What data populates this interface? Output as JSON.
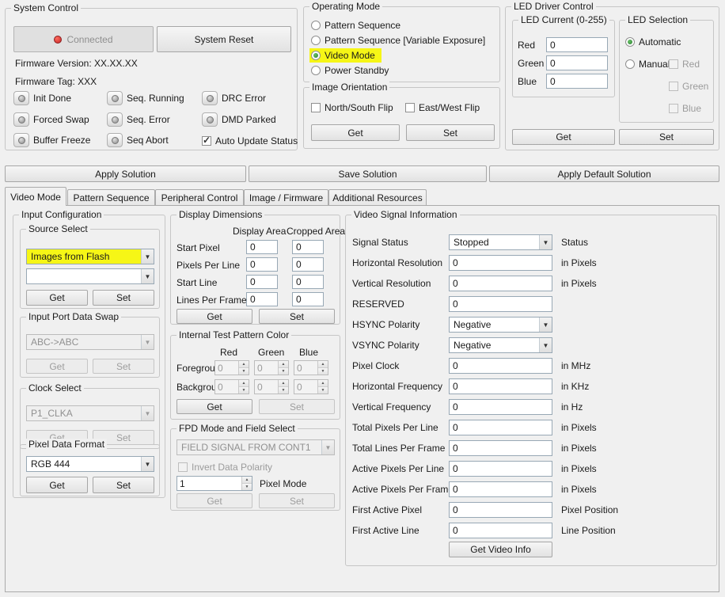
{
  "colors": {
    "highlight": "#f6f616",
    "window_bg": "#f0f0f0",
    "connected_led": "#c62828"
  },
  "system_control": {
    "title": "System Control",
    "connected_button": "Connected",
    "system_reset_button": "System Reset",
    "firmware_version_label": "Firmware Version:  XX.XX.XX",
    "firmware_tag_label": "Firmware Tag:   XXX",
    "status_leds": [
      {
        "label": "Init Done"
      },
      {
        "label": "Seq. Running"
      },
      {
        "label": "DRC Error"
      },
      {
        "label": "Forced Swap"
      },
      {
        "label": "Seq. Error"
      },
      {
        "label": "DMD Parked"
      },
      {
        "label": "Buffer Freeze"
      },
      {
        "label": "Seq Abort"
      }
    ],
    "auto_update_checkbox": {
      "label": "Auto Update Status",
      "checked": true
    }
  },
  "operating_mode": {
    "title": "Operating Mode",
    "options": [
      {
        "label": "Pattern Sequence",
        "selected": false,
        "highlighted": false
      },
      {
        "label": "Pattern Sequence [Variable Exposure]",
        "selected": false,
        "highlighted": false
      },
      {
        "label": "Video Mode",
        "selected": true,
        "highlighted": true
      },
      {
        "label": "Power Standby",
        "selected": false,
        "highlighted": false
      }
    ]
  },
  "image_orientation": {
    "title": "Image Orientation",
    "north_south_flip_label": "North/South Flip",
    "east_west_flip_label": "East/West Flip",
    "get_button": "Get",
    "set_button": "Set"
  },
  "led_driver_control": {
    "title": "LED Driver Control",
    "led_current": {
      "title": "LED Current (0-255)",
      "rows": [
        {
          "label": "Red",
          "value": "0"
        },
        {
          "label": "Green",
          "value": "0"
        },
        {
          "label": "Blue",
          "value": "0"
        }
      ]
    },
    "led_selection": {
      "title": "LED Selection",
      "automatic_label": "Automatic",
      "manual_label": "Manual",
      "channel_checkboxes": [
        {
          "label": "Red"
        },
        {
          "label": "Green"
        },
        {
          "label": "Blue"
        }
      ]
    },
    "get_button": "Get",
    "set_button": "Set"
  },
  "solution_bar": {
    "apply_solution_button": "Apply Solution",
    "save_solution_button": "Save Solution",
    "apply_default_solution_button": "Apply Default Solution"
  },
  "tabs": [
    {
      "label": "Video Mode",
      "active": true
    },
    {
      "label": "Pattern Sequence",
      "active": false
    },
    {
      "label": "Peripheral Control",
      "active": false
    },
    {
      "label": "Image / Firmware",
      "active": false
    },
    {
      "label": "Additional Resources",
      "active": false
    }
  ],
  "input_configuration": {
    "title": "Input Configuration",
    "source_select": {
      "title": "Source Select",
      "selected_value": "Images from Flash",
      "secondary_value": "",
      "get_button": "Get",
      "set_button": "Set"
    },
    "input_port_data_swap": {
      "title": "Input Port Data Swap",
      "selected_value": "ABC->ABC",
      "get_button": "Get",
      "set_button": "Set"
    },
    "clock_select": {
      "title": "Clock Select",
      "selected_value": "P1_CLKA",
      "get_button": "Get",
      "set_button": "Set"
    },
    "pixel_data_format": {
      "title": "Pixel Data Format",
      "selected_value": "RGB 444",
      "get_button": "Get",
      "set_button": "Set"
    }
  },
  "display_dimensions": {
    "title": "Display Dimensions",
    "col_headers": [
      "Display Area",
      "Cropped Area"
    ],
    "rows": [
      {
        "label": "Start Pixel",
        "display_area": "0",
        "cropped_area": "0"
      },
      {
        "label": "Pixels Per Line",
        "display_area": "0",
        "cropped_area": "0"
      },
      {
        "label": "Start Line",
        "display_area": "0",
        "cropped_area": "0"
      },
      {
        "label": "Lines Per Frame",
        "display_area": "0",
        "cropped_area": "0"
      }
    ],
    "get_button": "Get",
    "set_button": "Set"
  },
  "internal_test_pattern_color": {
    "title": "Internal Test Pattern Color",
    "col_headers": [
      "Red",
      "Green",
      "Blue"
    ],
    "rows": [
      {
        "label": "Foreground",
        "red": "0",
        "green": "0",
        "blue": "0"
      },
      {
        "label": "Background",
        "red": "0",
        "green": "0",
        "blue": "0"
      }
    ],
    "get_button": "Get",
    "set_button": "Set"
  },
  "fpd_mode": {
    "title": "FPD Mode and Field Select",
    "field_select_value": "FIELD SIGNAL FROM CONT1",
    "invert_data_polarity_label": "Invert Data Polarity",
    "pixel_mode_value": "1",
    "pixel_mode_label": "Pixel Mode",
    "get_button": "Get",
    "set_button": "Set"
  },
  "video_signal_information": {
    "title": "Video Signal Information",
    "rows": [
      {
        "label": "Signal Status",
        "control": "combo",
        "value": "Stopped",
        "suffix": "Status"
      },
      {
        "label": "Horizontal Resolution",
        "control": "input",
        "value": "0",
        "suffix": "in Pixels"
      },
      {
        "label": "Vertical Resolution",
        "control": "input",
        "value": "0",
        "suffix": "in Pixels"
      },
      {
        "label": "RESERVED",
        "control": "input",
        "value": "0",
        "suffix": ""
      },
      {
        "label": "HSYNC Polarity",
        "control": "combo",
        "value": "Negative",
        "suffix": ""
      },
      {
        "label": "VSYNC Polarity",
        "control": "combo",
        "value": "Negative",
        "suffix": ""
      },
      {
        "label": "Pixel Clock",
        "control": "input",
        "value": "0",
        "suffix": "in MHz"
      },
      {
        "label": "Horizontal Frequency",
        "control": "input",
        "value": "0",
        "suffix": "in KHz"
      },
      {
        "label": "Vertical Frequency",
        "control": "input",
        "value": "0",
        "suffix": "in Hz"
      },
      {
        "label": "Total Pixels Per Line",
        "control": "input",
        "value": "0",
        "suffix": "in Pixels"
      },
      {
        "label": "Total Lines Per Frame",
        "control": "input",
        "value": "0",
        "suffix": "in Pixels"
      },
      {
        "label": "Active Pixels Per Line",
        "control": "input",
        "value": "0",
        "suffix": "in Pixels"
      },
      {
        "label": "Active Pixels Per Frame",
        "control": "input",
        "value": "0",
        "suffix": "in Pixels"
      },
      {
        "label": "First Active Pixel",
        "control": "input",
        "value": "0",
        "suffix": "Pixel Position"
      },
      {
        "label": "First Active Line",
        "control": "input",
        "value": "0",
        "suffix": "Line Position"
      }
    ],
    "get_video_info_button": "Get Video Info"
  }
}
